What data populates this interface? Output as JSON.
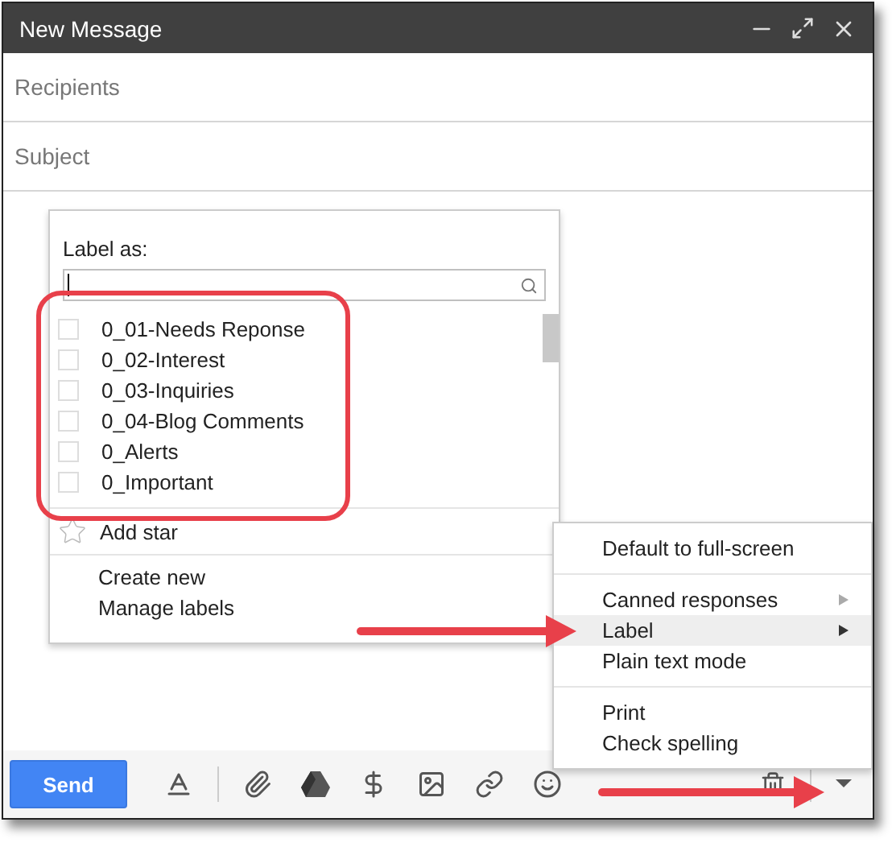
{
  "window": {
    "title": "New Message"
  },
  "fields": [
    {
      "placeholder": "Recipients"
    },
    {
      "placeholder": "Subject"
    }
  ],
  "label_popup": {
    "heading": "Label as:",
    "labels": [
      {
        "name": "0_01-Needs Reponse",
        "checked": false
      },
      {
        "name": "0_02-Interest",
        "checked": false
      },
      {
        "name": "0_03-Inquiries",
        "checked": false
      },
      {
        "name": "0_04-Blog Comments",
        "checked": false
      },
      {
        "name": "0_Alerts",
        "checked": false
      },
      {
        "name": "0_Important",
        "checked": false
      }
    ],
    "add_star": "Add star",
    "actions": [
      "Create new",
      "Manage labels"
    ]
  },
  "menu": {
    "sections": [
      [
        {
          "label": "Default to full-screen",
          "submenu": false,
          "selected": false
        }
      ],
      [
        {
          "label": "Canned responses",
          "submenu": true,
          "selected": false
        },
        {
          "label": "Label",
          "submenu": true,
          "selected": true
        },
        {
          "label": "Plain text mode",
          "submenu": false,
          "selected": false
        }
      ],
      [
        {
          "label": "Print",
          "submenu": false,
          "selected": false
        },
        {
          "label": "Check spelling",
          "submenu": false,
          "selected": false
        }
      ]
    ]
  },
  "toolbar": {
    "send": "Send"
  }
}
